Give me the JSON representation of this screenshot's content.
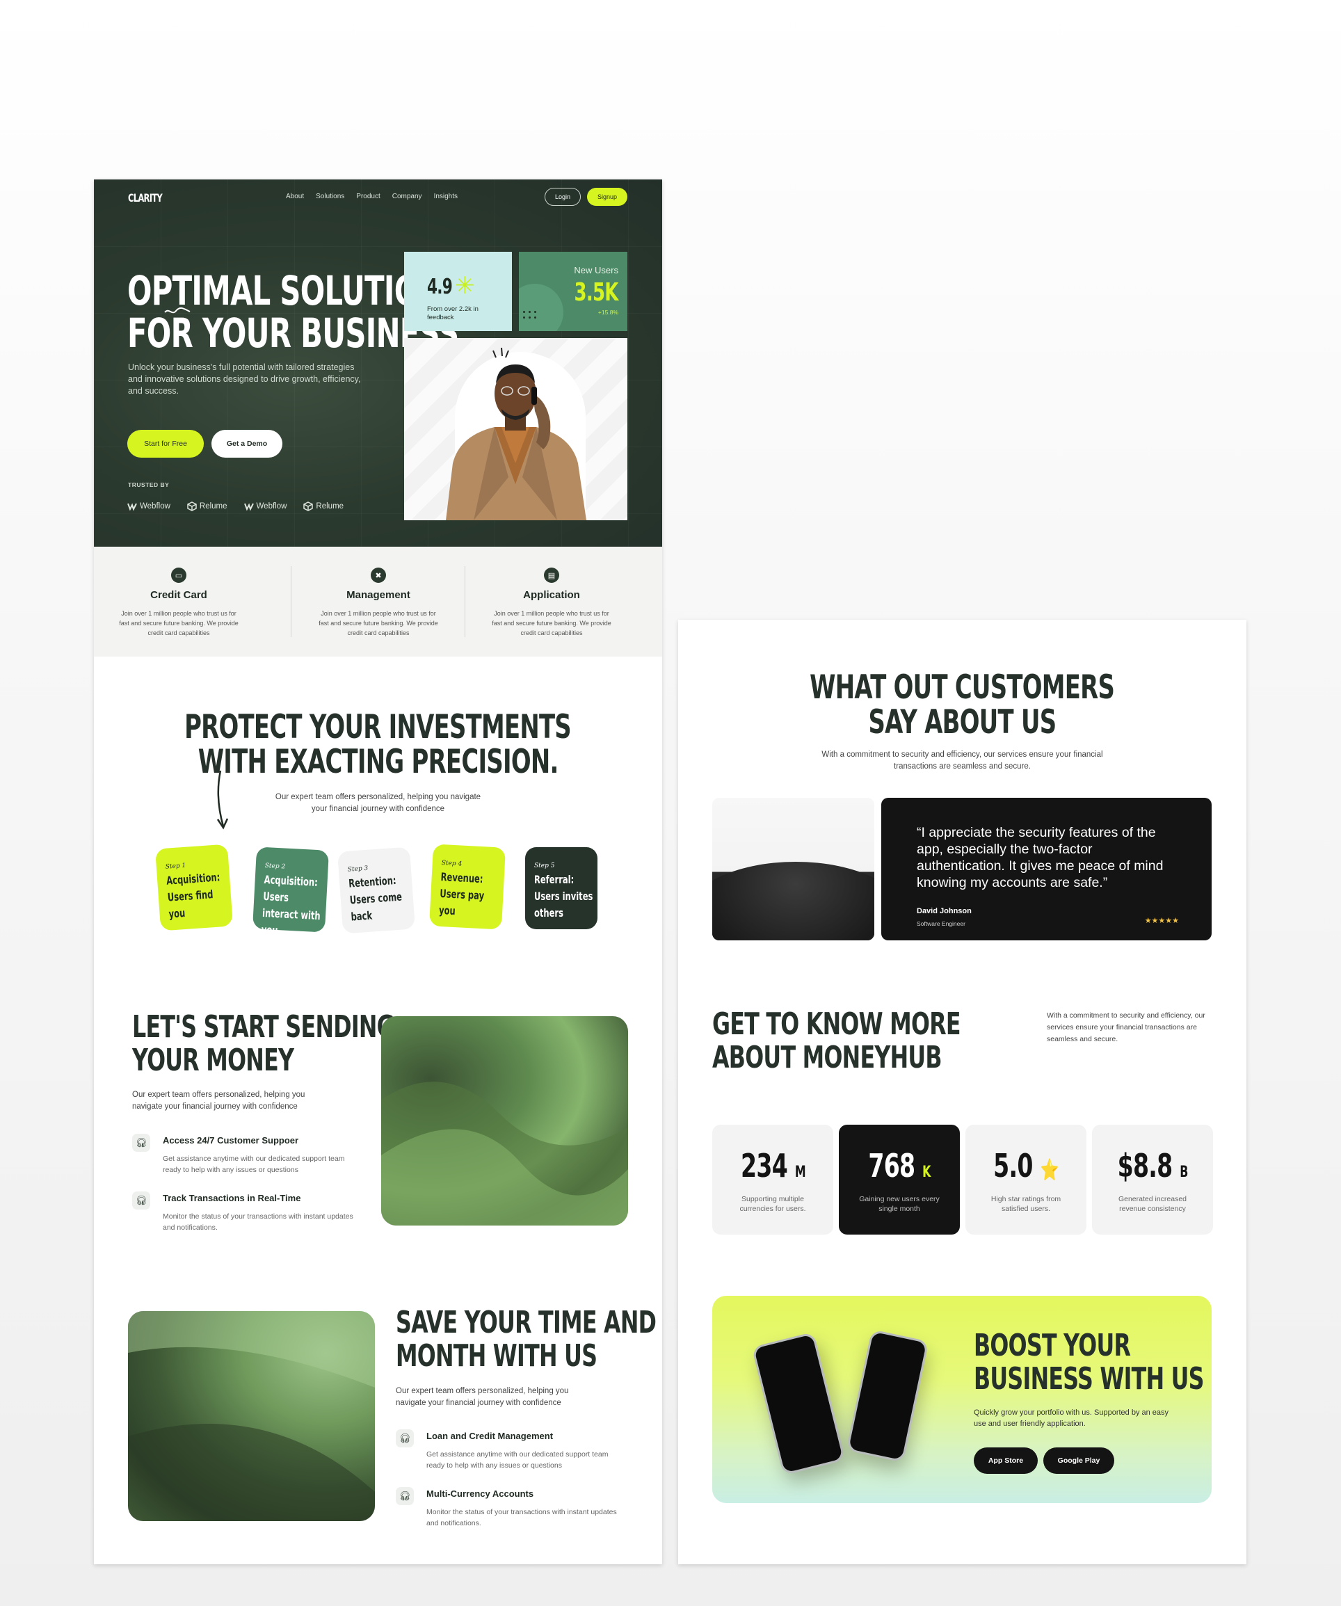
{
  "nav": {
    "logo": "CLARITY",
    "links": [
      "About",
      "Solutions",
      "Product",
      "Company",
      "Insights"
    ],
    "login": "Login",
    "signup": "Signup"
  },
  "hero": {
    "title_line1": "OPTIMAL SOLUTIONS",
    "title_line2": "FOR YOUR BUSINESS",
    "description": "Unlock your business's full potential with tailored strategies and innovative solutions designed to drive growth, efficiency, and success.",
    "cta_primary": "Start for Free",
    "cta_secondary": "Get a Demo",
    "trusted_label": "TRUSTED BY",
    "brands": [
      "Webflow",
      "Relume",
      "Webflow",
      "Relume"
    ],
    "rating_value": "4.9",
    "rating_caption": "From over 2.2k in feedback",
    "users_label": "New Users",
    "users_value": "3.5K",
    "users_change": "+15.8%"
  },
  "features": [
    {
      "title": "Credit Card",
      "desc": "Join over 1 million people who trust us for fast and secure future banking. We provide credit card capabilities"
    },
    {
      "title": "Management",
      "desc": "Join over 1 million people who trust us for fast and secure future banking. We provide credit card capabilities"
    },
    {
      "title": "Application",
      "desc": "Join over 1 million people who trust us for fast and secure future banking. We provide credit card capabilities"
    }
  ],
  "protect": {
    "title_line1": "PROTECT YOUR INVESTMENTS",
    "title_line2": "WITH EXACTING PRECISION.",
    "desc": "Our expert team offers personalized, helping you navigate your financial journey with confidence",
    "steps": [
      {
        "step": "Step 1",
        "text": "Acquisition: Users find you"
      },
      {
        "step": "Step 2",
        "text": "Acquisition: Users interact with you"
      },
      {
        "step": "Step 3",
        "text": "Retention: Users come back"
      },
      {
        "step": "Step 4",
        "text": "Revenue: Users pay you"
      },
      {
        "step": "Step 5",
        "text": "Referral: Users invites others"
      }
    ]
  },
  "send": {
    "title_line1": "LET'S START SENDING",
    "title_line2": "YOUR MONEY",
    "desc": "Our expert team offers personalized, helping you navigate your financial journey with confidence",
    "items": [
      {
        "title": "Access 24/7 Customer Suppoer",
        "desc": "Get assistance anytime with our dedicated support team ready to help with any issues or questions"
      },
      {
        "title": "Track Transactions in Real-Time",
        "desc": "Monitor the status of your transactions with instant updates and notifications."
      }
    ]
  },
  "save": {
    "title_line1": "SAVE YOUR TIME AND",
    "title_line2": "MONTH WITH US",
    "desc": "Our expert team offers personalized, helping you navigate your financial journey with confidence",
    "items": [
      {
        "title": "Loan and Credit Management",
        "desc": "Get assistance anytime with our dedicated support team ready to help with any issues or questions"
      },
      {
        "title": "Multi-Currency Accounts",
        "desc": "Monitor the status of your transactions with instant updates and notifications."
      }
    ]
  },
  "customers": {
    "title_line1": "WHAT OUT CUSTOMERS",
    "title_line2": "SAY ABOUT US",
    "desc": "With a commitment to security and efficiency, our services ensure your financial transactions are seamless and secure.",
    "quote": "“I appreciate the security features of the app, especially the two-factor authentication. It gives me peace of mind knowing my accounts are safe.”",
    "name": "David Johnson",
    "role": "Software Engineer",
    "stars": "★★★★★"
  },
  "about": {
    "title_line1": "GET TO KNOW MORE",
    "title_line2": "ABOUT MONEYHUB",
    "desc": "With a commitment to security and efficiency, our services ensure your financial transactions are seamless and secure.",
    "stats": [
      {
        "value": "234",
        "suffix": "M",
        "desc": "Supporting multiple currencies for users."
      },
      {
        "value": "768",
        "suffix": "K",
        "desc": "Gaining new users every single month"
      },
      {
        "value": "5.0",
        "suffix": "⭐",
        "desc": "High star ratings from satisfied users."
      },
      {
        "value": "$8.8",
        "suffix": "B",
        "desc": "Generated increased revenue consistency"
      }
    ]
  },
  "boost": {
    "title_line1": "BOOST YOUR",
    "title_line2": "BUSINESS WITH US",
    "desc": "Quickly grow your portfolio with us. Supported by an easy use and user friendly application.",
    "app_store": "App Store",
    "google_play": "Google Play"
  },
  "colors": {
    "dark_green": "#2b3a2e",
    "lime": "#d6f520",
    "mint": "#c9ecea",
    "green": "#4c8a68"
  }
}
